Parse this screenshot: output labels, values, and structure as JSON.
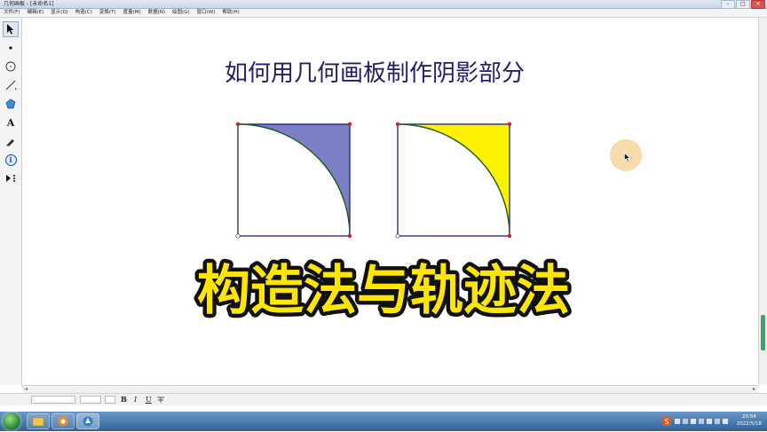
{
  "window": {
    "title": "几何画板 - [未命名1]",
    "controls": [
      "–",
      "□",
      "✕"
    ]
  },
  "menu": [
    "文件(F)",
    "编辑(E)",
    "显示(D)",
    "构造(C)",
    "变换(T)",
    "度量(M)",
    "数据(N)",
    "绘图(G)",
    "窗口(W)",
    "帮助(H)"
  ],
  "toolbox": {
    "tools": [
      "arrow-select-icon",
      "point-icon",
      "compass-circle-icon",
      "straightedge-line-icon",
      "polygon-icon",
      "text-tool-icon",
      "marker-pen-icon",
      "information-icon",
      "custom-tool-icon"
    ],
    "text_tool_label": "A",
    "info_tool_label": "i"
  },
  "canvas": {
    "heading": "如何用几何画板制作阴影部分",
    "caption": "构造法与轨迹法",
    "figures": [
      {
        "name": "quarter-circle-shaded-blue",
        "fill": "#7b7fc6"
      },
      {
        "name": "quarter-circle-shaded-yellow",
        "fill": "#fff200"
      }
    ],
    "colors": {
      "heading": "#1f1f6b",
      "square_stroke": "#1e1e8c",
      "arc_stroke": "#1a5a1a",
      "point_red": "#cc2222",
      "caption_fill": "#ffe600"
    }
  },
  "textbar": {
    "bold": "B",
    "italic": "I",
    "underline": "U"
  },
  "taskbar": {
    "time": "20:54",
    "date": "2022/5/18"
  }
}
